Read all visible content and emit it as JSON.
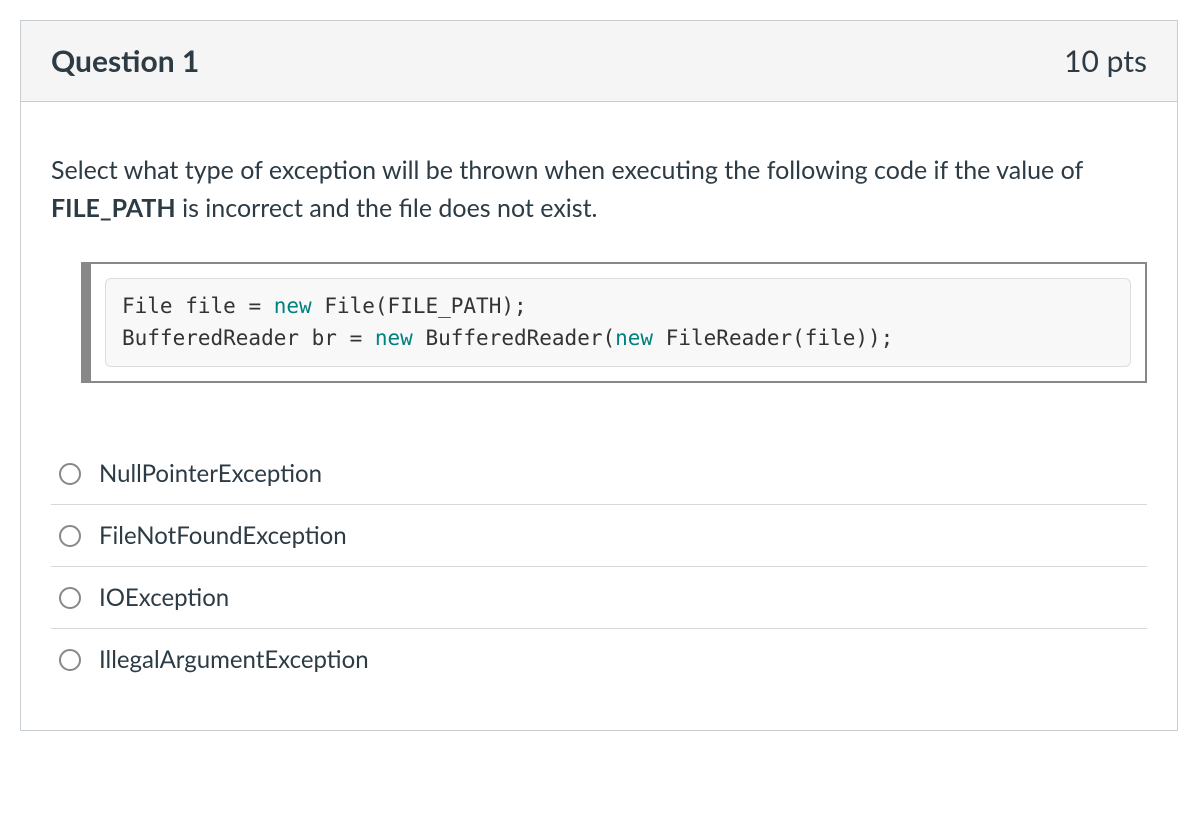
{
  "question": {
    "title": "Question 1",
    "points": "10 pts",
    "prompt_pre": "Select what type of exception will be thrown when executing the following code if the value of ",
    "prompt_bold": "FILE_PATH",
    "prompt_post": " is incorrect and the file does not exist.",
    "code": {
      "l1_t1": "File file ",
      "l1_eq": "=",
      "l1_sp1": " ",
      "l1_new": "new",
      "l1_sp2": " ",
      "l1_call": "File(FILE_PATH);",
      "l2_t1": "BufferedReader br ",
      "l2_eq": "=",
      "l2_sp1": " ",
      "l2_new1": "new",
      "l2_sp2": " ",
      "l2_call1": "BufferedReader(",
      "l2_new2": "new",
      "l2_sp3": " ",
      "l2_call2": "FileReader(file));"
    },
    "options": [
      {
        "label": "NullPointerException"
      },
      {
        "label": "FileNotFoundException"
      },
      {
        "label": "IOException"
      },
      {
        "label": "IllegalArgumentException"
      }
    ]
  }
}
